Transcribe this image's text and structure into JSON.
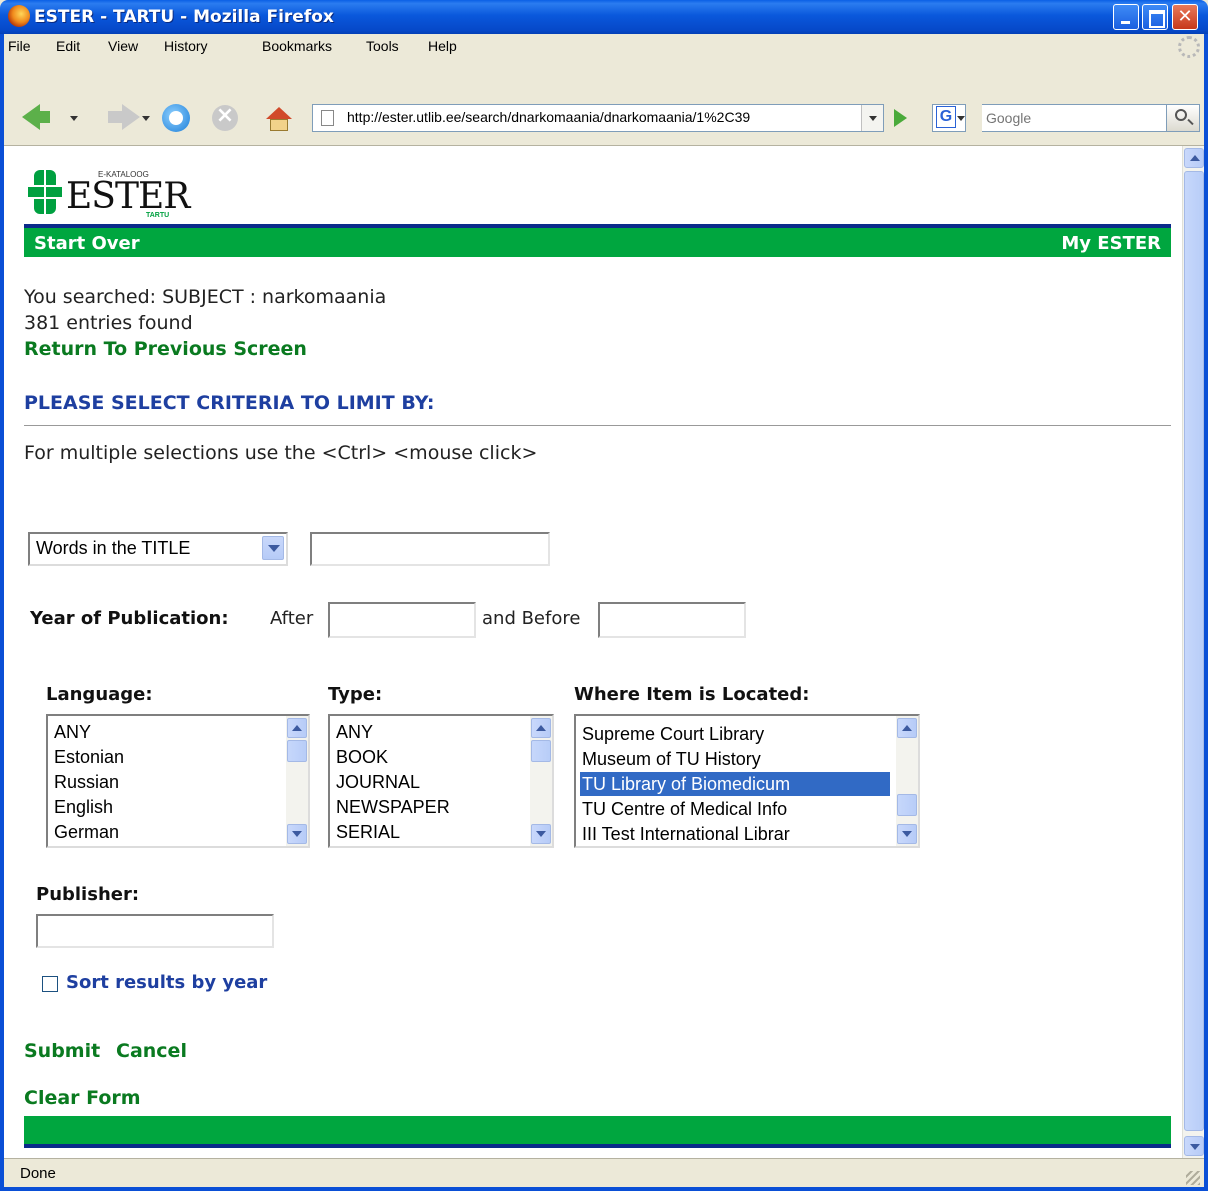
{
  "window": {
    "title": "ESTER - TARTU - Mozilla Firefox"
  },
  "menu": {
    "items": [
      "File",
      "Edit",
      "View",
      "History",
      "Bookmarks",
      "Tools",
      "Help"
    ]
  },
  "toolbar": {
    "url": "http://ester.utlib.ee/search/dnarkomaania/dnarkomaania/1%2C39",
    "search_engine_letter": "G",
    "search_placeholder": "Google"
  },
  "page": {
    "logo": {
      "word": "ESTER",
      "tagline": "E-KATALOOG",
      "city": "TARTU"
    },
    "nav": {
      "start_over": "Start Over",
      "my_ester": "My ESTER"
    },
    "search_summary": "You searched: SUBJECT : narkomaania",
    "entries_found": "381 entries found",
    "return_link": "Return To Previous Screen",
    "criteria_heading": "PLEASE SELECT CRITERIA TO LIMIT BY:",
    "multi_select_hint": "For multiple selections use the <Ctrl> <mouse click>",
    "field_select": {
      "selected": "Words in the TITLE"
    },
    "year": {
      "label": "Year of Publication:",
      "after": "After",
      "before": "and Before"
    },
    "language": {
      "label": "Language:",
      "options": [
        "ANY",
        "Estonian",
        "Russian",
        "English",
        "German"
      ]
    },
    "type": {
      "label": "Type:",
      "options": [
        "ANY",
        "BOOK",
        "JOURNAL",
        "NEWSPAPER",
        "SERIAL"
      ]
    },
    "location": {
      "label": "Where Item is Located:",
      "options": [
        "Supreme Court Library",
        "Museum of TU History",
        "TU Library of Biomedicum",
        "TU Centre of Medical Info",
        "III Test International Librar"
      ],
      "selected_index": 2
    },
    "publisher": {
      "label": "Publisher:"
    },
    "sort_checkbox": {
      "label": "Sort results by year",
      "checked": false
    },
    "actions": {
      "submit": "Submit",
      "cancel": "Cancel",
      "clear": "Clear Form"
    }
  },
  "status": {
    "text": "Done"
  },
  "colors": {
    "brand_green": "#00a63f",
    "link_green": "#0a7a20",
    "heading_blue": "#1e3fa0",
    "selection_blue": "#316ac5"
  }
}
